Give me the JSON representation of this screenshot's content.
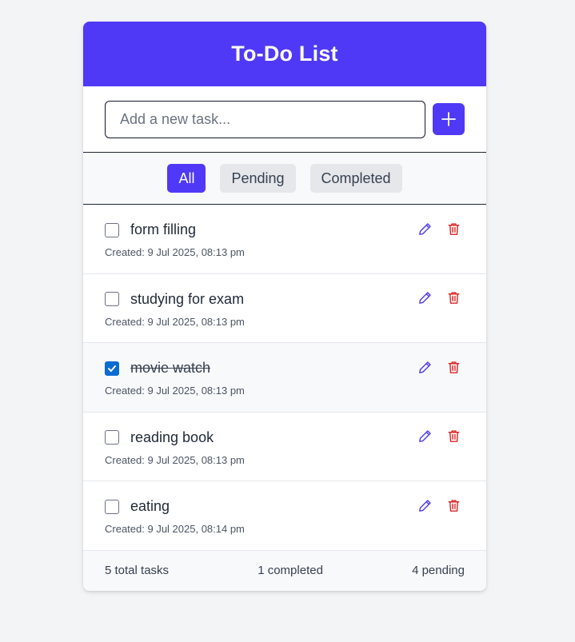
{
  "header": {
    "title": "To-Do List"
  },
  "add": {
    "placeholder": "Add a new task...",
    "value": ""
  },
  "filters": [
    {
      "label": "All",
      "active": true
    },
    {
      "label": "Pending",
      "active": false
    },
    {
      "label": "Completed",
      "active": false
    }
  ],
  "tasks": [
    {
      "text": "form filling",
      "created": "Created: 9 Jul 2025, 08:13 pm",
      "completed": false
    },
    {
      "text": "studying for exam",
      "created": "Created: 9 Jul 2025, 08:13 pm",
      "completed": false
    },
    {
      "text": "movie watch",
      "created": "Created: 9 Jul 2025, 08:13 pm",
      "completed": true
    },
    {
      "text": "reading book",
      "created": "Created: 9 Jul 2025, 08:13 pm",
      "completed": false
    },
    {
      "text": "eating",
      "created": "Created: 9 Jul 2025, 08:14 pm",
      "completed": false
    }
  ],
  "footer": {
    "total": "5 total tasks",
    "completed": "1 completed",
    "pending": "4 pending"
  },
  "colors": {
    "accent": "#4f39f6",
    "edit": "#4f39f6",
    "delete": "#dc2626",
    "checked": "#0b6bd3"
  },
  "icons": {
    "add": "plus-icon",
    "edit": "pencil-icon",
    "delete": "trash-icon",
    "check": "check-icon"
  }
}
